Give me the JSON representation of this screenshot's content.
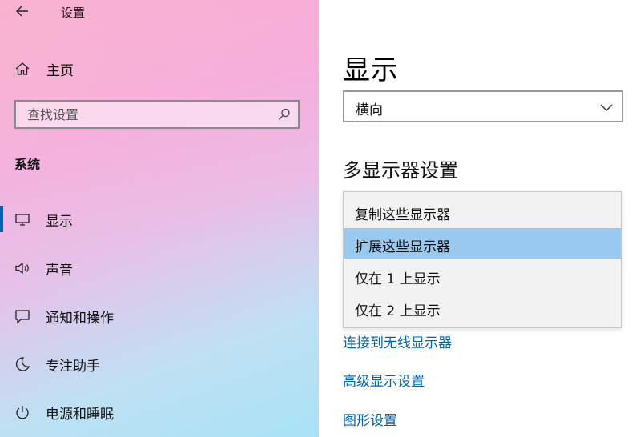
{
  "window": {
    "title": "设置"
  },
  "sidebar": {
    "home_label": "主页",
    "search_placeholder": "查找设置",
    "section_heading": "系统",
    "items": [
      {
        "label": "显示",
        "icon": "monitor-icon",
        "selected": true
      },
      {
        "label": "声音",
        "icon": "speaker-icon",
        "selected": false
      },
      {
        "label": "通知和操作",
        "icon": "notification-icon",
        "selected": false
      },
      {
        "label": "专注助手",
        "icon": "moon-icon",
        "selected": false
      },
      {
        "label": "电源和睡眠",
        "icon": "power-icon",
        "selected": false
      }
    ]
  },
  "main": {
    "title": "显示",
    "orientation_value": "横向",
    "multi_display_heading": "多显示器设置",
    "dropdown_options": [
      {
        "label": "复制这些显示器",
        "selected": false
      },
      {
        "label": "扩展这些显示器",
        "selected": true
      },
      {
        "label": "仅在 1 上显示",
        "selected": false
      },
      {
        "label": "仅在 2 上显示",
        "selected": false
      }
    ],
    "links": [
      "连接到无线显示器",
      "高级显示设置",
      "图形设置"
    ]
  },
  "colors": {
    "accent": "#0063b1",
    "selected_option_bg": "#99c9ee"
  }
}
